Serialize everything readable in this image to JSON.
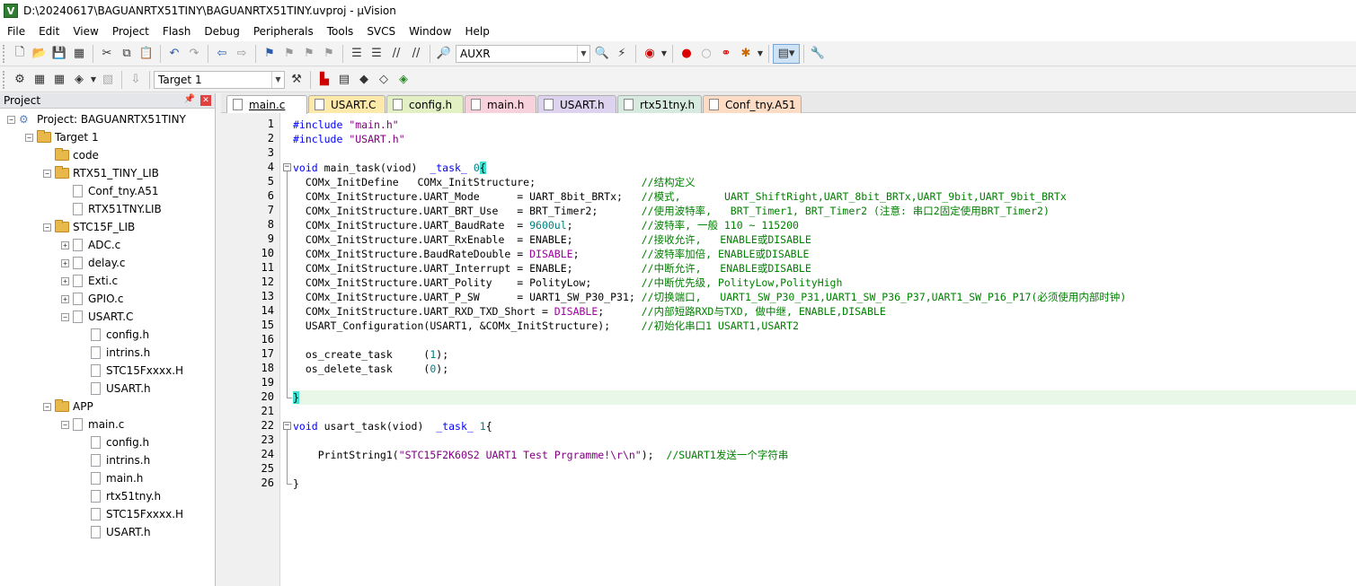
{
  "window": {
    "title": "D:\\20240617\\BAGUANRTX51TINY\\BAGUANRTX51TINY.uvproj - µVision",
    "app_icon": "V"
  },
  "menu": [
    "File",
    "Edit",
    "View",
    "Project",
    "Flash",
    "Debug",
    "Peripherals",
    "Tools",
    "SVCS",
    "Window",
    "Help"
  ],
  "toolbar": {
    "find_combo_value": "AUXR",
    "target_combo_value": "Target 1"
  },
  "project_panel": {
    "title": "Project",
    "tree": [
      {
        "label": "Project: BAGUANRTX51TINY",
        "type": "project",
        "level": 0,
        "expander": "-"
      },
      {
        "label": "Target 1",
        "type": "target",
        "level": 1,
        "expander": "-"
      },
      {
        "label": "code",
        "type": "folder",
        "level": 2,
        "expander": ""
      },
      {
        "label": "RTX51_TINY_LIB",
        "type": "folder",
        "level": 2,
        "expander": "-"
      },
      {
        "label": "Conf_tny.A51",
        "type": "file",
        "level": 3,
        "expander": ""
      },
      {
        "label": "RTX51TNY.LIB",
        "type": "file",
        "level": 3,
        "expander": ""
      },
      {
        "label": "STC15F_LIB",
        "type": "folder",
        "level": 2,
        "expander": "-"
      },
      {
        "label": "ADC.c",
        "type": "file",
        "level": 3,
        "expander": "+"
      },
      {
        "label": "delay.c",
        "type": "file",
        "level": 3,
        "expander": "+"
      },
      {
        "label": "Exti.c",
        "type": "file",
        "level": 3,
        "expander": "+"
      },
      {
        "label": "GPIO.c",
        "type": "file",
        "level": 3,
        "expander": "+"
      },
      {
        "label": "USART.C",
        "type": "file",
        "level": 3,
        "expander": "-"
      },
      {
        "label": "config.h",
        "type": "file",
        "level": 4,
        "expander": ""
      },
      {
        "label": "intrins.h",
        "type": "file",
        "level": 4,
        "expander": ""
      },
      {
        "label": "STC15Fxxxx.H",
        "type": "file",
        "level": 4,
        "expander": ""
      },
      {
        "label": "USART.h",
        "type": "file",
        "level": 4,
        "expander": ""
      },
      {
        "label": "APP",
        "type": "folder",
        "level": 2,
        "expander": "-"
      },
      {
        "label": "main.c",
        "type": "file",
        "level": 3,
        "expander": "-"
      },
      {
        "label": "config.h",
        "type": "file",
        "level": 4,
        "expander": ""
      },
      {
        "label": "intrins.h",
        "type": "file",
        "level": 4,
        "expander": ""
      },
      {
        "label": "main.h",
        "type": "file",
        "level": 4,
        "expander": ""
      },
      {
        "label": "rtx51tny.h",
        "type": "file",
        "level": 4,
        "expander": ""
      },
      {
        "label": "STC15Fxxxx.H",
        "type": "file",
        "level": 4,
        "expander": ""
      },
      {
        "label": "USART.h",
        "type": "file",
        "level": 4,
        "expander": ""
      }
    ]
  },
  "tabs": [
    {
      "label": "main.c",
      "color": "#ffffff",
      "active": true
    },
    {
      "label": "USART.C",
      "color": "#fde9a9",
      "active": false
    },
    {
      "label": "config.h",
      "color": "#e3f0c4",
      "active": false
    },
    {
      "label": "main.h",
      "color": "#f7d1dc",
      "active": false
    },
    {
      "label": "USART.h",
      "color": "#ddd3ef",
      "active": false
    },
    {
      "label": "rtx51tny.h",
      "color": "#d6eadf",
      "active": false
    },
    {
      "label": "Conf_tny.A51",
      "color": "#fddcc6",
      "active": false
    }
  ],
  "colors": {
    "keyword": "#0000ff",
    "string": "#800080",
    "number": "#008080",
    "comment": "#008000",
    "current_line": "#e8f7e8",
    "brace_match": "#40e0d0"
  },
  "editor": {
    "current_line": 20,
    "lines": [
      {
        "n": "1",
        "segs": [
          [
            "pp",
            "#include "
          ],
          [
            "str",
            "\"main.h\""
          ]
        ]
      },
      {
        "n": "2",
        "segs": [
          [
            "pp",
            "#include "
          ],
          [
            "str",
            "\"USART.h\""
          ]
        ]
      },
      {
        "n": "3",
        "segs": []
      },
      {
        "n": "4",
        "segs": [
          [
            "kw",
            "void"
          ],
          [
            "",
            " main_task(viod)  "
          ],
          [
            "kw",
            "_task_"
          ],
          [
            "",
            " "
          ],
          [
            "num",
            "0"
          ],
          [
            "br",
            "{"
          ]
        ]
      },
      {
        "n": "5",
        "segs": [
          [
            "",
            "  COMx_InitDefine   COMx_InitStructure;                 "
          ],
          [
            "cm",
            "//结构定义"
          ]
        ]
      },
      {
        "n": "6",
        "segs": [
          [
            "",
            "  COMx_InitStructure.UART_Mode      = UART_8bit_BRTx;   "
          ],
          [
            "cm",
            "//模式,       UART_ShiftRight,UART_8bit_BRTx,UART_9bit,UART_9bit_BRTx"
          ]
        ]
      },
      {
        "n": "7",
        "segs": [
          [
            "",
            "  COMx_InitStructure.UART_BRT_Use   = BRT_Timer2;       "
          ],
          [
            "cm",
            "//使用波特率,   BRT_Timer1, BRT_Timer2 (注意: 串口2固定使用BRT_Timer2)"
          ]
        ]
      },
      {
        "n": "8",
        "segs": [
          [
            "",
            "  COMx_InitStructure.UART_BaudRate  = "
          ],
          [
            "num",
            "9600ul"
          ],
          [
            "",
            ";           "
          ],
          [
            "cm",
            "//波特率, 一般 110 ~ 115200"
          ]
        ]
      },
      {
        "n": "9",
        "segs": [
          [
            "",
            "  COMx_InitStructure.UART_RxEnable  = ENABLE;           "
          ],
          [
            "cm",
            "//接收允许,   ENABLE或DISABLE"
          ]
        ]
      },
      {
        "n": "10",
        "segs": [
          [
            "",
            "  COMx_InitStructure.BaudRateDouble = "
          ],
          [
            "dis",
            "DISABLE"
          ],
          [
            "",
            ";          "
          ],
          [
            "cm",
            "//波特率加倍, ENABLE或DISABLE"
          ]
        ]
      },
      {
        "n": "11",
        "segs": [
          [
            "",
            "  COMx_InitStructure.UART_Interrupt = ENABLE;           "
          ],
          [
            "cm",
            "//中断允许,   ENABLE或DISABLE"
          ]
        ]
      },
      {
        "n": "12",
        "segs": [
          [
            "",
            "  COMx_InitStructure.UART_Polity    = PolityLow;        "
          ],
          [
            "cm",
            "//中断优先级, PolityLow,PolityHigh"
          ]
        ]
      },
      {
        "n": "13",
        "segs": [
          [
            "",
            "  COMx_InitStructure.UART_P_SW      = UART1_SW_P30_P31; "
          ],
          [
            "cm",
            "//切换端口,   UART1_SW_P30_P31,UART1_SW_P36_P37,UART1_SW_P16_P17(必须使用内部时钟)"
          ]
        ]
      },
      {
        "n": "14",
        "segs": [
          [
            "",
            "  COMx_InitStructure.UART_RXD_TXD_Short = "
          ],
          [
            "dis",
            "DISABLE"
          ],
          [
            "",
            ";      "
          ],
          [
            "cm",
            "//内部短路RXD与TXD, 做中继, ENABLE,DISABLE"
          ]
        ]
      },
      {
        "n": "15",
        "segs": [
          [
            "",
            "  USART_Configuration(USART1, &COMx_InitStructure);     "
          ],
          [
            "cm",
            "//初始化串口1 USART1,USART2"
          ]
        ]
      },
      {
        "n": "16",
        "segs": []
      },
      {
        "n": "17",
        "segs": [
          [
            "",
            "  os_create_task     ("
          ],
          [
            "num",
            "1"
          ],
          [
            "",
            ");"
          ]
        ]
      },
      {
        "n": "18",
        "segs": [
          [
            "",
            "  os_delete_task     ("
          ],
          [
            "num",
            "0"
          ],
          [
            "",
            ");"
          ]
        ]
      },
      {
        "n": "19",
        "segs": []
      },
      {
        "n": "20",
        "segs": [
          [
            "br",
            "}"
          ]
        ]
      },
      {
        "n": "21",
        "segs": []
      },
      {
        "n": "22",
        "segs": [
          [
            "kw",
            "void"
          ],
          [
            "",
            " usart_task(viod)  "
          ],
          [
            "kw",
            "_task_"
          ],
          [
            "",
            " "
          ],
          [
            "num",
            "1"
          ],
          [
            "",
            "{"
          ]
        ]
      },
      {
        "n": "23",
        "segs": []
      },
      {
        "n": "24",
        "segs": [
          [
            "",
            "    PrintString1("
          ],
          [
            "str",
            "\"STC15F2K60S2 UART1 Test Prgramme!\\r\\n\""
          ],
          [
            "",
            ");  "
          ],
          [
            "cm",
            "//SUART1发送一个字符串"
          ]
        ]
      },
      {
        "n": "25",
        "segs": []
      },
      {
        "n": "26",
        "segs": [
          [
            "",
            "}"
          ]
        ]
      }
    ]
  }
}
